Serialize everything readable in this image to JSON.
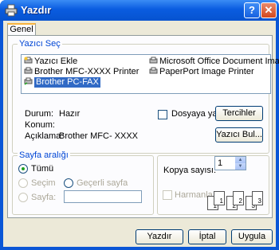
{
  "window": {
    "title": "Yazdır",
    "help_label": "?",
    "close_label": "✕"
  },
  "tabs": [
    "Genel"
  ],
  "select_printer": {
    "title": "Yazıcı Seç",
    "printers": [
      {
        "name": "Yazıcı Ekle",
        "icon": "add-printer-icon",
        "selected": false
      },
      {
        "name": "Brother MFC-XXXX  Printer",
        "icon": "printer-icon",
        "selected": false
      },
      {
        "name": "Brother PC-FAX",
        "icon": "fax-printer-icon",
        "selected": true
      },
      {
        "name": "Microsoft Office Document Image",
        "icon": "printer-icon",
        "selected": false
      },
      {
        "name": "PaperPort Image Printer",
        "icon": "printer-icon",
        "selected": false
      }
    ],
    "status_label": "Durum:",
    "status_value": "Hazır",
    "location_label": "Konum:",
    "location_value": "",
    "comment_label": "Açıklama:",
    "comment_value": "Brother MFC- XXXX",
    "print_to_file_label": "Dosyaya yazdır",
    "preferences_button": "Tercihler",
    "find_printer_button": "Yazıcı Bul..."
  },
  "page_range": {
    "title": "Sayfa aralığı",
    "all_label": "Tümü",
    "selection_label": "Seçim",
    "current_page_label": "Geçerli sayfa",
    "pages_label": "Sayfa:",
    "pages_value": ""
  },
  "copies": {
    "label": "Kopya sayısı:",
    "value": "1",
    "collate_label": "Harmanla"
  },
  "footer": {
    "print_button": "Yazdır",
    "cancel_button": "İptal",
    "apply_button": "Uygula"
  },
  "colors": {
    "titlebar": "#0a56d6",
    "accent_text": "#0046d5",
    "selection": "#316ac5"
  }
}
